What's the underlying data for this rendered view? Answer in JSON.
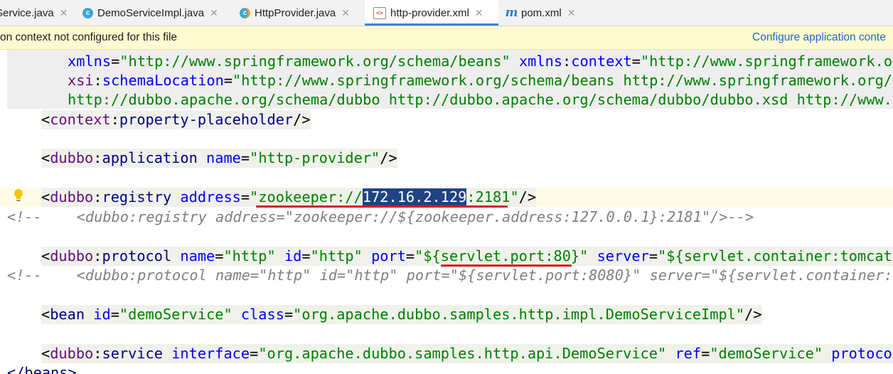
{
  "tabs": [
    {
      "label": "Service.java",
      "icon": "none",
      "active": false
    },
    {
      "label": "DemoServiceImpl.java",
      "icon": "class-icon",
      "active": false
    },
    {
      "label": "HttpProvider.java",
      "icon": "class-run-icon",
      "active": false
    },
    {
      "label": "http-provider.xml",
      "icon": "xml-file-icon",
      "active": true
    },
    {
      "label": "pom.xml",
      "icon": "maven-icon",
      "active": false
    }
  ],
  "tab_close_glyph": "✕",
  "notification": {
    "message": "on context not configured for this file",
    "link": "Configure application conte"
  },
  "code": {
    "l1_a": "xmlns",
    "l1_b": "=",
    "l1_c": "\"http://www.springframework.org/schema/beans\"",
    "l1_d": "xmlns",
    "l1_e": ":",
    "l1_f": "context",
    "l1_g": "=",
    "l1_h": "\"http://www.springframework.org",
    "l2_a": "xsi",
    "l2_b": ":",
    "l2_c": "schemaLocation",
    "l2_d": "=",
    "l2_e": "\"http://www.springframework.org/schema/beans http://www.springframework.org/sc",
    "l3": "http://dubbo.apache.org/schema/dubbo http://dubbo.apache.org/schema/dubbo/dubbo.xsd http://www.sp",
    "l4_ns": "context",
    "l4_name": "property-placeholder",
    "l5_ns": "dubbo",
    "l5_name": "application",
    "l5_attr": "name",
    "l5_val": "\"http-provider\"",
    "l6_ns": "dubbo",
    "l6_name": "registry",
    "l6_attr": "address",
    "l6_val1": "\"zookeeper://",
    "l6_sel": "172.16.2.129",
    "l6_val2": ":2181\"",
    "l7": "<!--    <dubbo:registry address=\"zookeeper://${zookeeper.address:127.0.0.1}:2181\"/>-->",
    "l8_ns": "dubbo",
    "l8_name": "protocol",
    "l8_a1": "name",
    "l8_v1": "\"http\"",
    "l8_a2": "id",
    "l8_v2": "\"http\"",
    "l8_a3": "port",
    "l8_v3": "\"${servlet.port:80}\"",
    "l8_a4": "server",
    "l8_v4": "\"${servlet.container:tomcat}\"",
    "l9": "<!--    <dubbo:protocol name=\"http\" id=\"http\" port=\"${servlet.port:8080}\" server=\"${servlet.container:to",
    "l10_name": "bean",
    "l10_a1": "id",
    "l10_v1": "\"demoService\"",
    "l10_a2": "class",
    "l10_v2": "\"org.apache.dubbo.samples.http.impl.DemoServiceImpl\"",
    "l11_ns": "dubbo",
    "l11_name": "service",
    "l11_a1": "interface",
    "l11_v1": "\"org.apache.dubbo.samples.http.api.DemoService\"",
    "l11_a2": "ref",
    "l11_v2": "\"demoService\"",
    "l11_a3": "protocol",
    "l12": "</beans>"
  },
  "colors": {
    "tag": "#000080",
    "namespace": "#660e7a",
    "attribute": "#0000ff",
    "value": "#008000",
    "comment": "#808080",
    "selection": "#214283",
    "underline": "#d41f1f",
    "notification_bg": "#fffad1",
    "active_tab_underline": "#4083c9"
  }
}
